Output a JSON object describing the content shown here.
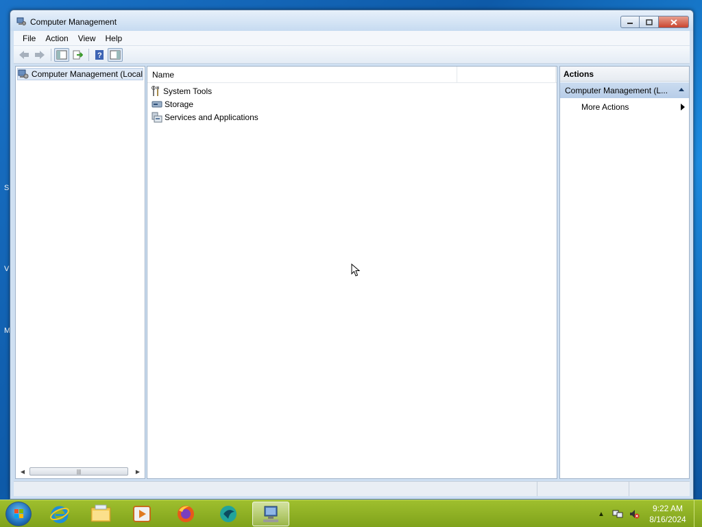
{
  "window": {
    "title": "Computer Management",
    "title_icon": "computer-management-icon",
    "controls": {
      "minimize": "minimize",
      "maximize": "maximize",
      "close": "close"
    }
  },
  "menu": [
    "File",
    "Action",
    "View",
    "Help"
  ],
  "toolbar": {
    "buttons": [
      "back-arrow-icon",
      "forward-arrow-icon",
      "show-hide-console-tree-icon",
      "export-list-icon",
      "help-icon",
      "show-hide-action-pane-icon"
    ]
  },
  "tree": {
    "root_label": "Computer Management (Local"
  },
  "list": {
    "column_name": "Name",
    "items": [
      {
        "label": "System Tools",
        "icon": "system-tools-icon"
      },
      {
        "label": "Storage",
        "icon": "storage-icon"
      },
      {
        "label": "Services and Applications",
        "icon": "services-applications-icon"
      }
    ]
  },
  "actions": {
    "header": "Actions",
    "section_title": "Computer Management (L...",
    "items": [
      {
        "label": "More Actions"
      }
    ]
  },
  "taskbar": {
    "apps": [
      "start-orb",
      "internet-explorer-icon",
      "file-explorer-icon",
      "media-player-icon",
      "firefox-icon",
      "app-icon",
      "computer-management-taskbar-icon"
    ],
    "clock_time": "9:22 AM",
    "clock_date": "8/16/2024"
  },
  "colors": {
    "taskbar": "#8fb026",
    "actions_section": "#c1d5ec",
    "window_frame": "#cfe0f2"
  }
}
